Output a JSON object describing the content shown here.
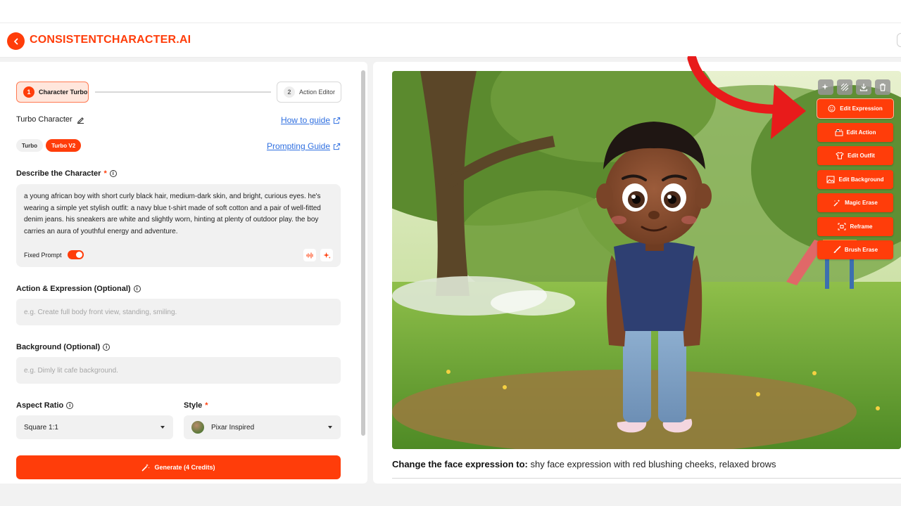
{
  "app": {
    "brand": "CONSISTENTCHARACTER.AI"
  },
  "stepper": {
    "step1": {
      "num": "1",
      "label": "Character Turbo"
    },
    "step2": {
      "num": "2",
      "label": "Action Editor"
    }
  },
  "turbo": {
    "title": "Turbo Character",
    "how_to": "How to guide",
    "prompting": "Prompting Guide",
    "modes": [
      "Turbo",
      "Turbo V2"
    ],
    "active_mode": "Turbo V2"
  },
  "describe": {
    "label": "Describe the Character",
    "required": "*",
    "value": "a young african boy with short curly black hair, medium-dark skin, and bright, curious eyes. he's wearing a simple yet stylish outfit: a navy blue t-shirt made of soft cotton and a pair of well-fitted denim jeans. his sneakers are white and slightly worn, hinting at plenty of outdoor play. the boy carries an aura of youthful energy and adventure.",
    "fixed_prompt_label": "Fixed Prompt",
    "fixed_prompt_on": true
  },
  "action": {
    "label": "Action & Expression (Optional)",
    "placeholder": "e.g. Create full body front view, standing, smiling."
  },
  "background": {
    "label": "Background (Optional)",
    "placeholder": "e.g. Dimly lit cafe background."
  },
  "aspect": {
    "label": "Aspect Ratio",
    "value": "Square 1:1"
  },
  "style": {
    "label": "Style",
    "required": "*",
    "value": "Pixar Inspired"
  },
  "generate": {
    "label": "Generate (4 Credits)"
  },
  "edit_menu": [
    {
      "label": "Edit Expression",
      "icon": "face-edit-icon"
    },
    {
      "label": "Edit Action",
      "icon": "action-icon"
    },
    {
      "label": "Edit Outfit",
      "icon": "shirt-icon"
    },
    {
      "label": "Edit Background",
      "icon": "image-icon"
    },
    {
      "label": "Magic Erase",
      "icon": "magic-wand-icon"
    },
    {
      "label": "Reframe",
      "icon": "reframe-icon"
    },
    {
      "label": "Brush Erase",
      "icon": "brush-icon"
    }
  ],
  "caption": {
    "prefix": "Change the face expression to:",
    "text": " shy face expression with red blushing cheeks, relaxed brows"
  },
  "colors": {
    "accent": "#ff3d0a",
    "link": "#2f6fe0"
  }
}
